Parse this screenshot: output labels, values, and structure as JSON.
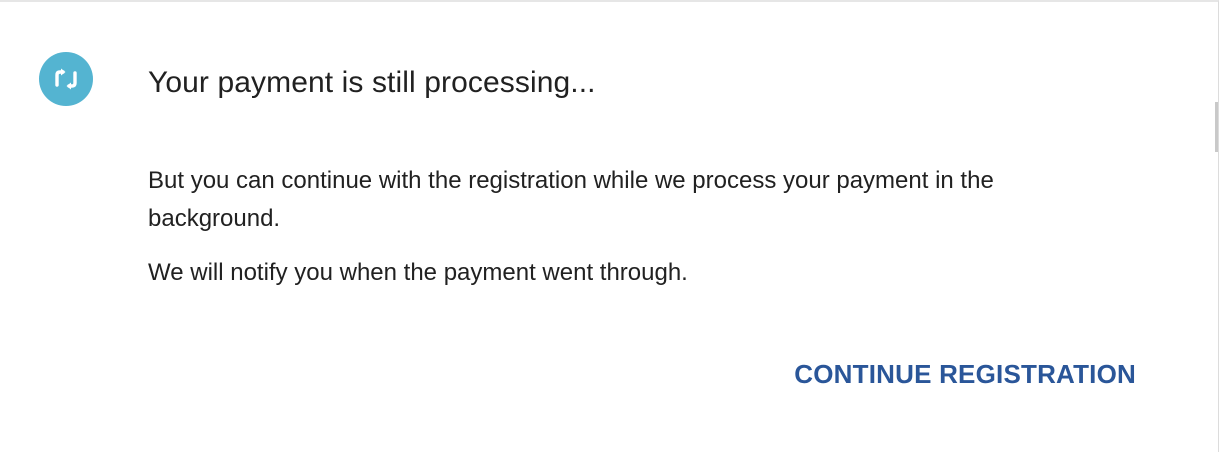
{
  "dialog": {
    "icon": "sync-arrows-icon",
    "title": "Your payment is still processing...",
    "message_1": "But you can continue with the registration while we process your payment in the background.",
    "message_2": "We will notify you when the payment went through.",
    "continue_label": "CONTINUE REGISTRATION"
  },
  "colors": {
    "icon_bg": "#54b4d1",
    "button_text": "#2a5699",
    "text": "#212121"
  }
}
